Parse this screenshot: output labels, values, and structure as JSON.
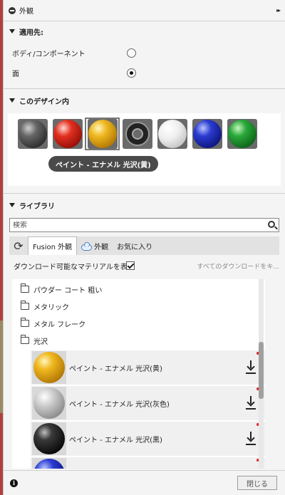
{
  "panel": {
    "title": "外観",
    "expand_glyph": "▸▸"
  },
  "apply_to": {
    "header": "適用先:",
    "options": [
      {
        "label": "ボディ/コンポーネント",
        "selected": false
      },
      {
        "label": "面",
        "selected": true
      }
    ]
  },
  "in_design": {
    "header": "このデザイン内",
    "swatches": [
      {
        "name": "dark-grey",
        "selected": false
      },
      {
        "name": "red",
        "selected": false
      },
      {
        "name": "yellow",
        "selected": true
      },
      {
        "name": "ring",
        "selected": false
      },
      {
        "name": "white",
        "selected": false
      },
      {
        "name": "blue",
        "selected": false
      },
      {
        "name": "green",
        "selected": false
      }
    ],
    "tooltip": "ペイント - エナメル 光沢(黄)"
  },
  "library": {
    "header": "ライブラリ",
    "search_placeholder": "検索",
    "refresh_glyph": "⟳",
    "tabs": [
      "Fusion 外観",
      "外観",
      "お気に入り"
    ],
    "downloadable_label": "ダウンロード可能なマテリアルを表示",
    "downloadable_checked": true,
    "download_all": "すべてのダウンロードをキ...",
    "folders": [
      "パウダー コート 粗い",
      "メタリック",
      "メタル フレーク",
      "光沢"
    ],
    "materials": [
      {
        "name": "ペイント - エナメル 光沢(黄)",
        "color": "yellow"
      },
      {
        "name": "ペイント - エナメル 光沢(灰色)",
        "color": "grey"
      },
      {
        "name": "ペイント - エナメル 光沢(黒)",
        "color": "black"
      },
      {
        "name": "",
        "color": "blue"
      }
    ]
  },
  "footer": {
    "info_glyph": "i",
    "close_label": "閉じる"
  }
}
